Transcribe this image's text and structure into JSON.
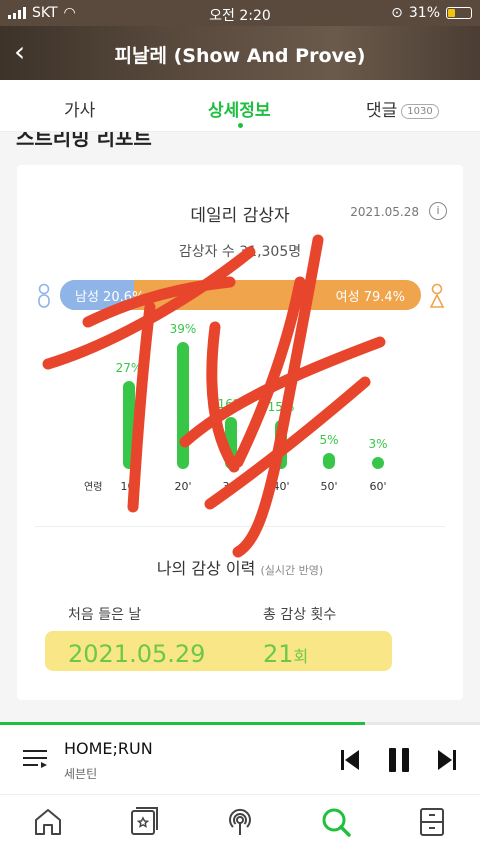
{
  "status": {
    "carrier": "SKT",
    "time": "오전 2:20",
    "battery": "31%"
  },
  "header": {
    "title": "피날레 (Show And Prove)"
  },
  "tabs": [
    {
      "label": "가사"
    },
    {
      "label": "상세정보",
      "active": true
    },
    {
      "label": "댓글",
      "badge": "1030"
    }
  ],
  "section": {
    "title": "스트리밍 리포트"
  },
  "daily": {
    "title": "데일리 감상자",
    "date": "2021.05.28",
    "listeners": "감상자 수 31,305명",
    "male_label": "남성 20.6%",
    "female_label": "여성 79.4%",
    "male_share": 20.6,
    "age_label": "연령",
    "ages": [
      {
        "age": "10'",
        "pct": "27%",
        "value": 27
      },
      {
        "age": "20'",
        "pct": "39%",
        "value": 39
      },
      {
        "age": "30'",
        "pct": "16%",
        "value": 16
      },
      {
        "age": "40'",
        "pct": "15%",
        "value": 15
      },
      {
        "age": "50'",
        "pct": "5%",
        "value": 5
      },
      {
        "age": "60'",
        "pct": "3%",
        "value": 3
      }
    ]
  },
  "history": {
    "title": "나의 감상 이력",
    "note": "(실시간 반영)",
    "first_label": "처음 들은 날",
    "first_value": "2021.05.29",
    "count_label": "총 감상 횟수",
    "count_value": "21",
    "count_unit": "회"
  },
  "player": {
    "song": "HOME;RUN",
    "artist": "세븐틴",
    "progress": 0.76
  },
  "colors": {
    "accent": "#1fbf3f",
    "male": "#8fb5e8",
    "female": "#f0a44c",
    "scribble": "#e8462c"
  },
  "icons": [
    "playlist-icon",
    "prev-icon",
    "pause-icon",
    "next-icon",
    "home-icon",
    "library-icon",
    "podcast-icon",
    "search-icon",
    "storage-icon"
  ]
}
